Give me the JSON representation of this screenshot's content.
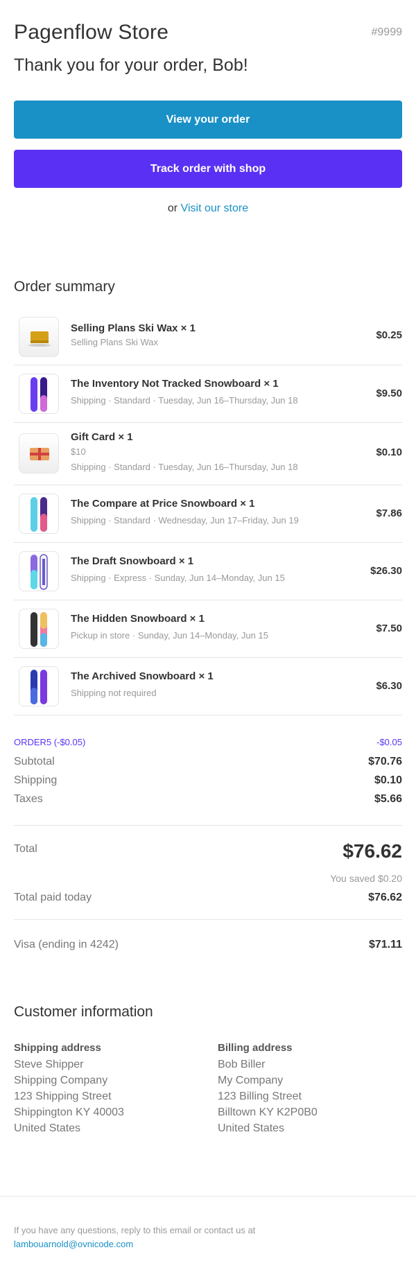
{
  "header": {
    "store_name": "Pagenflow Store",
    "order_number": "#9999",
    "greeting": "Thank you for your order, Bob!"
  },
  "actions": {
    "view_order": "View your order",
    "track_order": "Track order with shop",
    "or_text": "or",
    "visit_store": "Visit our store"
  },
  "summary": {
    "title": "Order summary",
    "items": [
      {
        "title": "Selling Plans Ski Wax × 1",
        "sub1": "Selling Plans Ski Wax",
        "sub2": "",
        "price": "$0.25",
        "icon": "ski-wax-icon"
      },
      {
        "title": "The Inventory Not Tracked Snowboard × 1",
        "sub1": "Shipping · Standard · Tuesday, Jun 16–Thursday, Jun 18",
        "sub2": "",
        "price": "$9.50",
        "icon": "snowboard-icon"
      },
      {
        "title": "Gift Card × 1",
        "sub1": "$10",
        "sub2": "Shipping · Standard · Tuesday, Jun 16–Thursday, Jun 18",
        "price": "$0.10",
        "icon": "gift-card-icon"
      },
      {
        "title": "The Compare at Price Snowboard × 1",
        "sub1": "Shipping · Standard · Wednesday, Jun 17–Friday, Jun 19",
        "sub2": "",
        "price": "$7.86",
        "icon": "snowboard-icon"
      },
      {
        "title": "The Draft Snowboard × 1",
        "sub1": "Shipping · Express · Sunday, Jun 14–Monday, Jun 15",
        "sub2": "",
        "price": "$26.30",
        "icon": "snowboard-icon"
      },
      {
        "title": "The Hidden Snowboard × 1",
        "sub1": "Pickup in store · Sunday, Jun 14–Monday, Jun 15",
        "sub2": "",
        "price": "$7.50",
        "icon": "snowboard-icon"
      },
      {
        "title": "The Archived Snowboard × 1",
        "sub1": "Shipping not required",
        "sub2": "",
        "price": "$6.30",
        "icon": "snowboard-icon"
      }
    ]
  },
  "totals": {
    "discount_label": "ORDER5 (-$0.05)",
    "discount_value": "-$0.05",
    "subtotal_label": "Subtotal",
    "subtotal_value": "$70.76",
    "shipping_label": "Shipping",
    "shipping_value": "$0.10",
    "taxes_label": "Taxes",
    "taxes_value": "$5.66",
    "total_label": "Total",
    "total_value": "$76.62",
    "saved_text": "You saved $0.20",
    "paid_label": "Total paid today",
    "paid_value": "$76.62",
    "payment_label": "Visa (ending in 4242)",
    "payment_value": "$71.11"
  },
  "customer": {
    "title": "Customer information",
    "shipping": {
      "title": "Shipping address",
      "lines": [
        "Steve Shipper",
        "Shipping Company",
        "123 Shipping Street",
        "Shippington KY 40003",
        "United States"
      ]
    },
    "billing": {
      "title": "Billing address",
      "lines": [
        "Bob Biller",
        "My Company",
        "123 Billing Street",
        "Billtown KY K2P0B0",
        "United States"
      ]
    }
  },
  "footer": {
    "text": "If you have any questions, reply to this email or contact us at",
    "email": "lambouarnold@ovnicode.com"
  },
  "colors": {
    "primary_blue": "#1990c6",
    "shop_purple": "#5a31f4",
    "text_dark": "#333333",
    "text_muted": "#999999"
  }
}
